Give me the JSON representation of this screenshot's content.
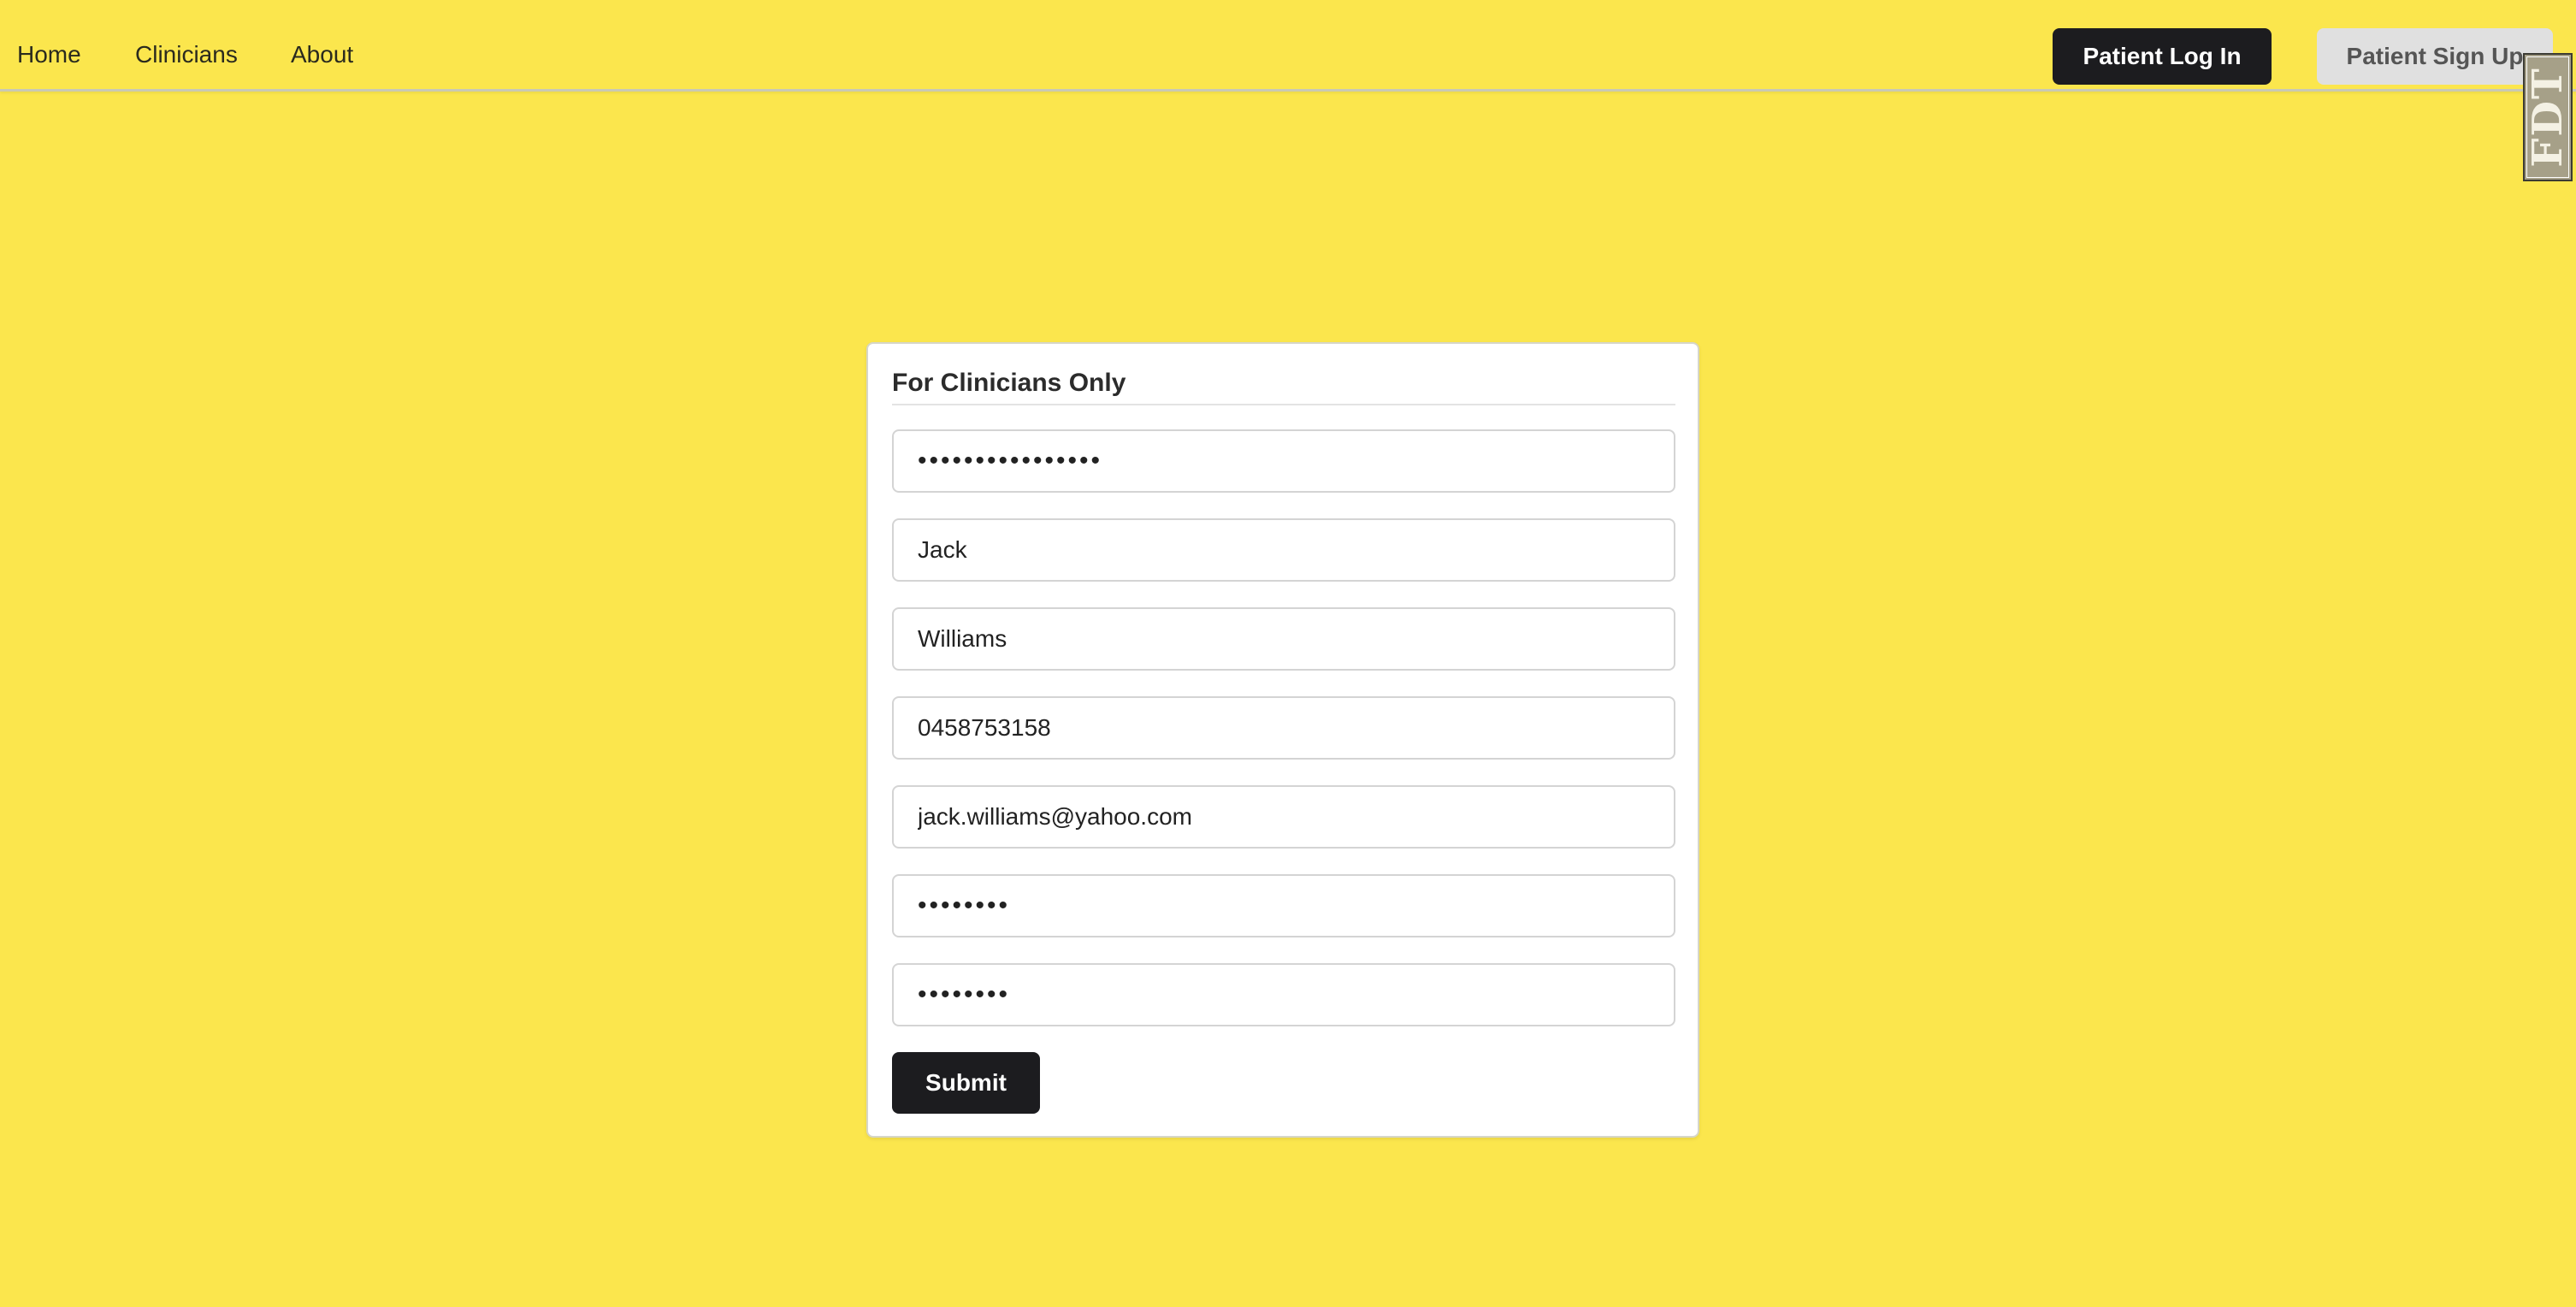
{
  "nav": {
    "links": [
      {
        "label": "Home"
      },
      {
        "label": "Clinicians"
      },
      {
        "label": "About"
      }
    ],
    "login_label": "Patient Log In",
    "signup_label": "Patient Sign Up"
  },
  "badge": {
    "text": "FDT"
  },
  "form": {
    "title": "For Clinicians Only",
    "fields": {
      "access_code": "••••••••••••••••",
      "first_name": "Jack",
      "last_name": "Williams",
      "phone": "0458753158",
      "email": "jack.williams@yahoo.com",
      "password": "••••••••",
      "confirm_password": "••••••••"
    },
    "submit_label": "Submit"
  },
  "colors": {
    "background": "#fbe64d",
    "primary_button": "#1c1c1f",
    "secondary_button": "#e0e0e0",
    "card": "#ffffff"
  }
}
